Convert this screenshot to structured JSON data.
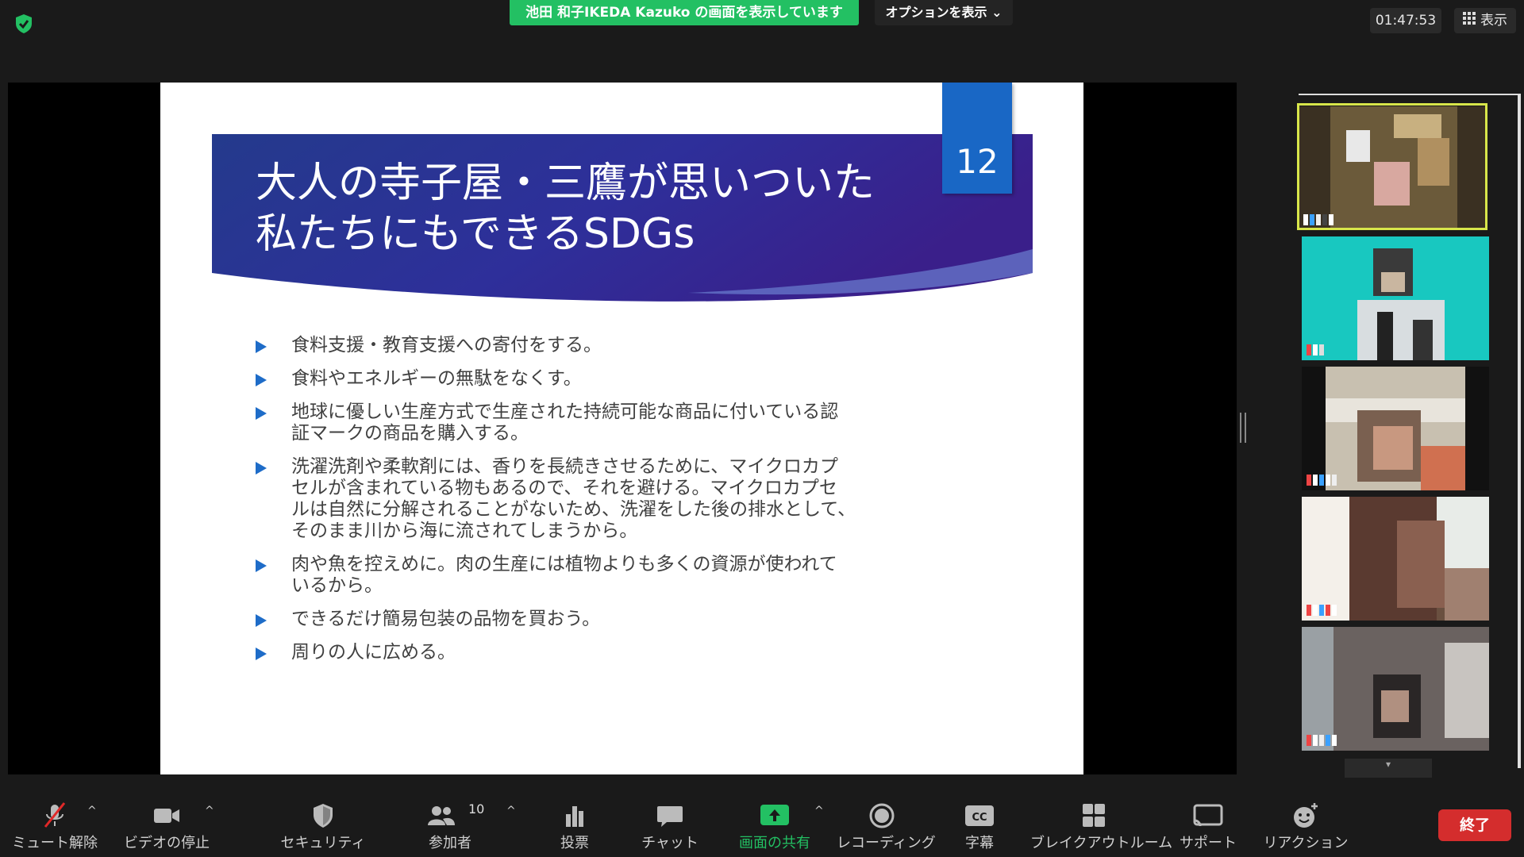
{
  "top": {
    "share_banner": "池田 和子IKEDA Kazuko の画面を表示しています",
    "options_label": "オプションを表示",
    "clock": "01:47:53",
    "view_label": "表示"
  },
  "slide": {
    "title": "大人の寺子屋・三鷹が思いついた\n私たちにもできるSDGs",
    "page_number": "12",
    "bullets": [
      "食料支援・教育支援への寄付をする。",
      "食料やエネルギーの無駄をなくす。",
      "地球に優しい生産方式で生産された持続可能な商品に付いている認\n証マークの商品を購入する。",
      "洗濯洗剤や柔軟剤には、香りを長続きさせるために、マイクロカプ\nセルが含まれている物もあるので、それを避ける。マイクロカプセ\nルは自然に分解されることがないため、洗濯をした後の排水として、\nそのまま川から海に流されてしまうから。",
      "肉や魚を控えめに。肉の生産には植物よりも多くの資源が使われて\nいるから。",
      "できるだけ簡易包装の品物を買おう。",
      "周りの人に広める。"
    ]
  },
  "toolbar": {
    "mute": "ミュート解除",
    "video": "ビデオの停止",
    "security": "セキュリティ",
    "participants": "参加者",
    "participants_count": "10",
    "polls": "投票",
    "chat": "チャット",
    "share": "画面の共有",
    "record": "レコーディング",
    "captions": "字幕",
    "breakout": "ブレイクアウトルーム",
    "support": "サポート",
    "reactions": "リアクション",
    "end": "終了"
  },
  "colors": {
    "share_green": "#23c063",
    "end_red": "#d42d2d",
    "slide_blue": "#1967c5",
    "active_speaker": "#d8e64a"
  }
}
